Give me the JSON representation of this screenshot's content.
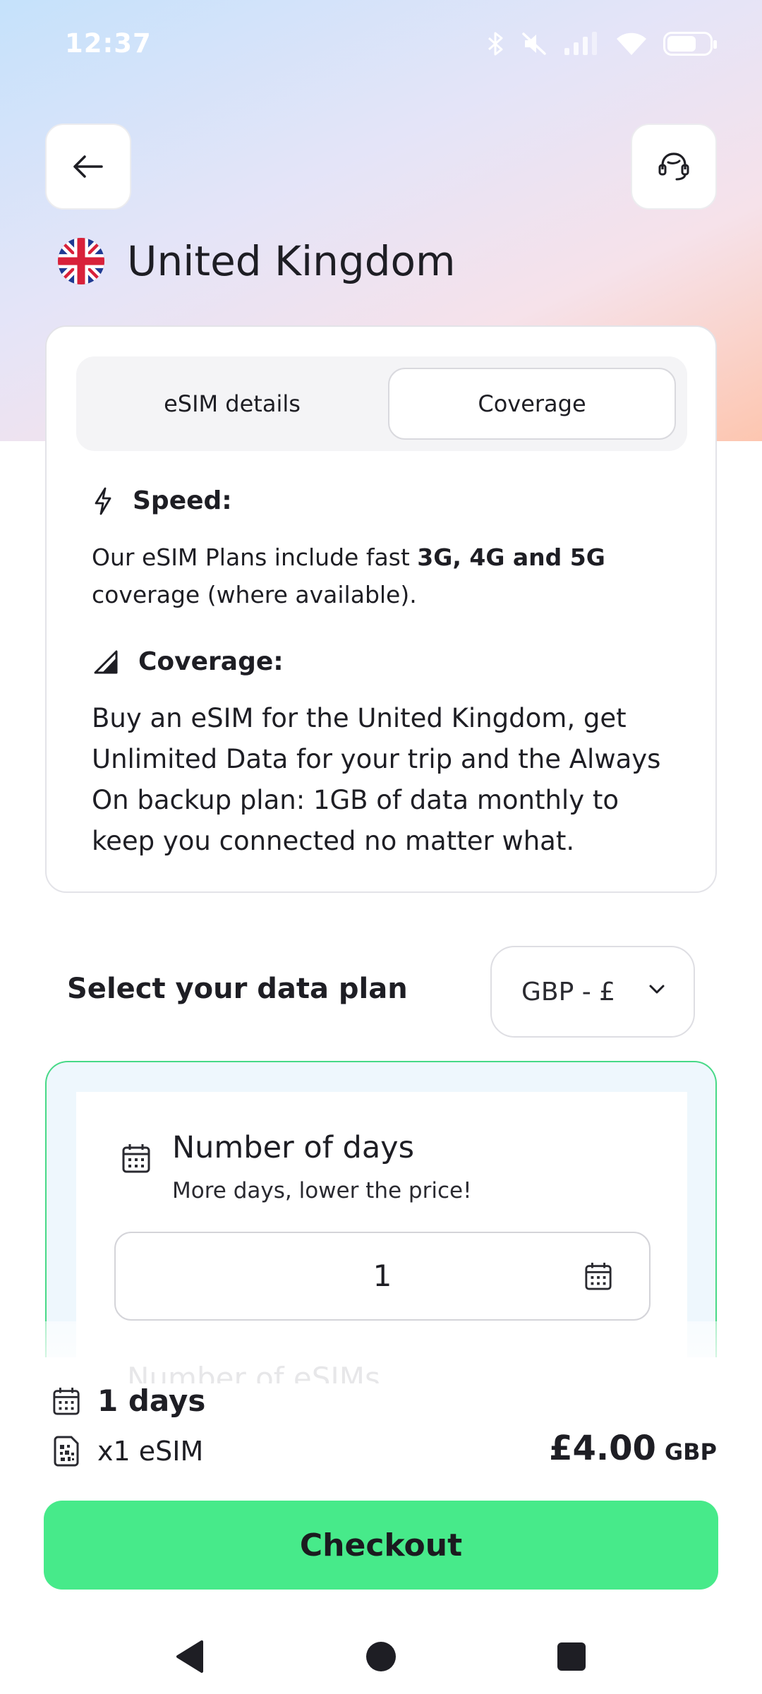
{
  "status_bar": {
    "time": "12:37",
    "icons": [
      "bluetooth-icon",
      "mute-icon",
      "signal-icon",
      "wifi-icon",
      "battery-icon"
    ]
  },
  "header": {
    "back_icon": "arrow-left-icon",
    "support_icon": "headset-icon",
    "country_name": "United Kingdom",
    "flag": "uk-flag"
  },
  "tabs": {
    "items": [
      {
        "label": "eSIM details",
        "selected": false
      },
      {
        "label": "Coverage",
        "selected": true
      }
    ]
  },
  "coverage_panel": {
    "speed_title": "Speed:",
    "speed_text_prefix": "Our eSIM Plans include fast ",
    "speed_text_bold": "3G, 4G and 5G",
    "speed_text_suffix": " coverage (where available).",
    "coverage_title": "Coverage:",
    "coverage_text": "Buy an eSIM for the United Kingdom, get Unlimited Data for your trip and the Always On backup plan: 1GB of data monthly to keep you connected no matter what."
  },
  "plan": {
    "title": "Select your data plan",
    "currency": "GBP - £",
    "days_title": "Number of days",
    "days_subtitle": "More days, lower the price!",
    "days_value": "1",
    "next_section_title": "Number of eSIMs"
  },
  "summary": {
    "days": "1 days",
    "esims": "x1 eSIM",
    "price": "£4.00",
    "price_currency": "GBP",
    "checkout_label": "Checkout"
  },
  "colors": {
    "accent_green": "#47ea8a",
    "plan_border": "#47d987",
    "hero_gradient_start": "#c5e2fb",
    "hero_gradient_end": "#fdc6b0"
  }
}
